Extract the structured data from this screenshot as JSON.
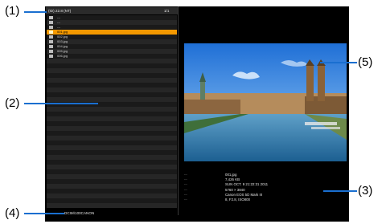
{
  "status_bar": {
    "left_text": "(ID) 22.8 (NT)",
    "page_count": "1/1"
  },
  "file_list": {
    "rows": [
      {
        "label": "---",
        "icon": "grid-icon",
        "selected": false
      },
      {
        "label": "---",
        "icon": "back-icon",
        "selected": false
      },
      {
        "label": "---",
        "icon": "folder-icon",
        "selected": false
      },
      {
        "label": "001.jpg",
        "icon": "image-file-icon",
        "selected": true
      },
      {
        "label": "002.jpg",
        "icon": "image-file-icon",
        "selected": false
      },
      {
        "label": "003.jpg",
        "icon": "image-file-icon",
        "selected": false
      },
      {
        "label": "004.jpg",
        "icon": "image-file-icon",
        "selected": false
      },
      {
        "label": "005.jpg",
        "icon": "image-file-icon",
        "selected": false
      },
      {
        "label": "006.jpg",
        "icon": "image-file-icon",
        "selected": false
      }
    ],
    "selected_color": "#f39800",
    "row_color_a": "#1a1a1a",
    "row_color_b": "#262626"
  },
  "preview": {
    "subject": "city-river-photo"
  },
  "file_info": {
    "rows": [
      {
        "label": "---",
        "value": "001.jpg"
      },
      {
        "label": "---",
        "value": "7,426 KB"
      },
      {
        "label": "---",
        "value": "SUN OCT. 9 21:22:31 2011"
      },
      {
        "label": "---",
        "value": "5760 × 3840"
      },
      {
        "label": "---",
        "value": "Canon EOS 5D Mark III"
      },
      {
        "label": "---",
        "value": "8, F2.8, ISO800"
      }
    ]
  },
  "path_bar": {
    "path": "DCIM\\100CANON"
  },
  "callouts": {
    "c1": "(1)",
    "c2": "(2)",
    "c3": "(3)",
    "c4": "(4)",
    "c5": "(5)",
    "leader_color": "#1a6fd0"
  }
}
